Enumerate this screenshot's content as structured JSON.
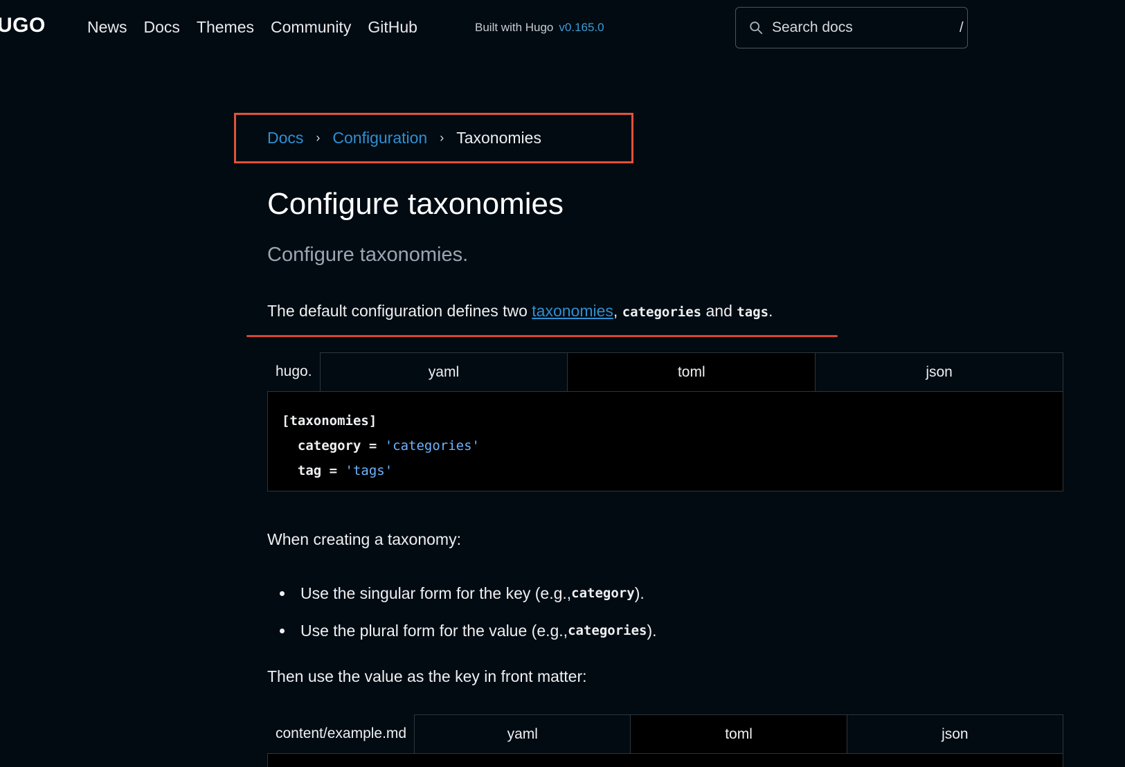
{
  "header": {
    "logo": "UGO",
    "nav": [
      "News",
      "Docs",
      "Themes",
      "Community",
      "GitHub"
    ],
    "built_with": "Built with Hugo",
    "version": "v0.165.0",
    "search_placeholder": "Search docs",
    "search_shortcut": "/"
  },
  "breadcrumb": {
    "items": [
      "Docs",
      "Configuration"
    ],
    "current": "Taxonomies"
  },
  "article": {
    "title": "Configure taxonomies",
    "lead": "Configure taxonomies.",
    "intro": {
      "before": "The default configuration defines two ",
      "link": "taxonomies",
      "comma": ",",
      "code1": "categories",
      "and": " and ",
      "code2": "tags",
      "end": "."
    },
    "codetabs1": {
      "filename": "hugo.",
      "tabs": [
        "yaml",
        "toml",
        "json"
      ],
      "lines": {
        "l1": "[taxonomies]",
        "l2_key": "  category = ",
        "l2_val": "'categories'",
        "l3_key": "  tag = ",
        "l3_val": "'tags'"
      }
    },
    "when_creating": "When creating a taxonomy:",
    "bullets": [
      {
        "before": "Use the singular form for the key (e.g., ",
        "code": "category",
        "after": ")."
      },
      {
        "before": "Use the plural form for the value (e.g., ",
        "code": "categories",
        "after": ")."
      }
    ],
    "then_use": "Then use the value as the key in front matter:",
    "codetabs2": {
      "filename": "content/example.md",
      "tabs": [
        "yaml",
        "toml",
        "json"
      ]
    }
  },
  "colors": {
    "background": "#020b12",
    "link": "#2f8fd1",
    "highlight": "#e2533a",
    "string": "#6eb4ff"
  }
}
